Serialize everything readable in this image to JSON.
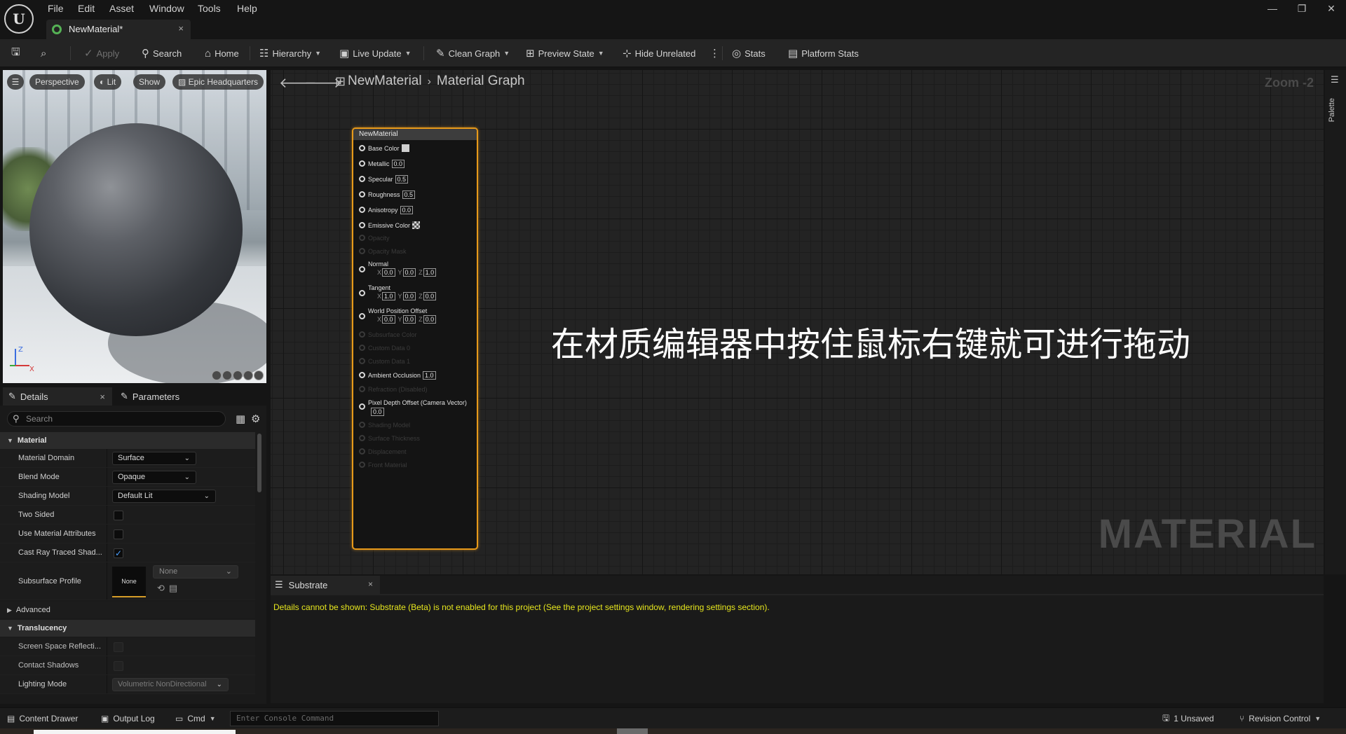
{
  "menu": [
    "File",
    "Edit",
    "Asset",
    "Window",
    "Tools",
    "Help"
  ],
  "document_tab": {
    "label": "NewMaterial*",
    "close": "×"
  },
  "window_controls": {
    "minimize": "—",
    "restore": "❐",
    "close": "✕"
  },
  "toolbar": {
    "apply": "Apply",
    "search": "Search",
    "home": "Home",
    "hierarchy": "Hierarchy",
    "live_update": "Live Update",
    "clean_graph": "Clean Graph",
    "preview_state": "Preview State",
    "hide_unrelated": "Hide Unrelated",
    "stats": "Stats",
    "platform_stats": "Platform Stats"
  },
  "viewport": {
    "perspective": "Perspective",
    "lit": "Lit",
    "show": "Show",
    "preview_scene": "Epic Headquarters"
  },
  "details": {
    "tab_details": "Details",
    "tab_parameters": "Parameters",
    "search_placeholder": "Search",
    "category_material": "Material",
    "material_domain_label": "Material Domain",
    "material_domain_value": "Surface",
    "blend_mode_label": "Blend Mode",
    "blend_mode_value": "Opaque",
    "shading_model_label": "Shading Model",
    "shading_model_value": "Default Lit",
    "two_sided_label": "Two Sided",
    "two_sided_checked": false,
    "use_material_attributes_label": "Use Material Attributes",
    "use_material_attributes_checked": false,
    "cast_ray_traced_label": "Cast Ray Traced Shad...",
    "cast_ray_traced_checked": true,
    "subsurface_profile_label": "Subsurface Profile",
    "subsurface_thumb": "None",
    "subsurface_value": "None",
    "category_advanced": "Advanced",
    "category_translucency": "Translucency",
    "ssr_label": "Screen Space Reflecti...",
    "contact_shadows_label": "Contact Shadows",
    "lighting_mode_label": "Lighting Mode",
    "lighting_mode_value": "Volumetric NonDirectional"
  },
  "graph": {
    "breadcrumb_asset": "NewMaterial",
    "breadcrumb_graph": "Material Graph",
    "zoom": "Zoom -2",
    "watermark": "MATERIAL",
    "overlay_caption": "在材质编辑器中按住鼠标右键就可进行拖动",
    "palette_label": "Palette"
  },
  "node": {
    "title": "NewMaterial",
    "base_color": "Base Color",
    "metallic": "Metallic",
    "metallic_value": "0.0",
    "specular": "Specular",
    "specular_value": "0.5",
    "roughness": "Roughness",
    "roughness_value": "0.5",
    "anisotropy": "Anisotropy",
    "anisotropy_value": "0.0",
    "emissive_color": "Emissive Color",
    "opacity": "Opacity",
    "opacity_mask": "Opacity Mask",
    "normal": "Normal",
    "normal_x": "0.0",
    "normal_y": "0.0",
    "normal_z": "1.0",
    "tangent": "Tangent",
    "tangent_x": "1.0",
    "tangent_y": "0.0",
    "tangent_z": "0.0",
    "world_position_offset": "World Position Offset",
    "wpo_x": "0.0",
    "wpo_y": "0.0",
    "wpo_z": "0.0",
    "subsurface_color": "Subsurface Color",
    "custom_data_0": "Custom Data 0",
    "custom_data_1": "Custom Data 1",
    "ambient_occlusion": "Ambient Occlusion",
    "ambient_occlusion_value": "1.0",
    "refraction": "Refraction (Disabled)",
    "pixel_depth_offset": "Pixel Depth Offset (Camera Vector)",
    "pixel_depth_offset_value": "0.0",
    "shading_model": "Shading Model",
    "surface_thickness": "Surface Thickness",
    "displacement": "Displacement",
    "front_material": "Front Material",
    "axis_x": "X",
    "axis_y": "Y",
    "axis_z": "Z"
  },
  "substrate": {
    "tab_label": "Substrate",
    "message": "Details cannot be shown: Substrate (Beta) is not enabled for this project (See the project settings window, rendering settings section)."
  },
  "statusbar": {
    "content_drawer": "Content Drawer",
    "output_log": "Output Log",
    "cmd": "Cmd",
    "console_placeholder": "Enter Console Command",
    "unsaved": "1 Unsaved",
    "revision_control": "Revision Control"
  },
  "colors": {
    "node_border": "#e89a1a",
    "warning_text": "#e6e61e",
    "checkbox_check": "#4aa0ff"
  }
}
